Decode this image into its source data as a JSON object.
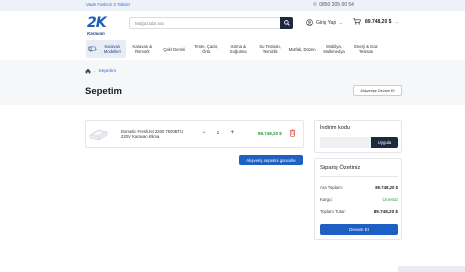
{
  "topbar": {
    "promo": "Vade Farksız 3 Taksit!",
    "phone": "0850 305 00 54"
  },
  "logo": {
    "mark": "2K",
    "sub": "Karavan"
  },
  "search": {
    "placeholder": "Mağazada ara"
  },
  "header": {
    "login_label": "Giriş Yap",
    "cart_amount": "89.748,20 $"
  },
  "nav": {
    "items": [
      {
        "label": "Karavan Modelleri"
      },
      {
        "label": "Karavan & Römork"
      },
      {
        "label": "Çekİ Demiri"
      },
      {
        "label": "Tente, Çadır, Örtü"
      },
      {
        "label": "Isıtma & Soğutma"
      },
      {
        "label": "Su Tesisatı, Temizlik"
      },
      {
        "label": "Mutfak, Düzen"
      },
      {
        "label": "Mobilya, Multimedya"
      },
      {
        "label": "Enerji & Gaz Tesisatı"
      }
    ]
  },
  "breadcrumb": {
    "current": "Sepetim"
  },
  "page": {
    "title": "Sepetim",
    "continue_label": "Alışverişe Devam Et"
  },
  "cart": {
    "items": [
      {
        "name": "Dometic FreshJet 2200 7500BTU 220V Karavan Klima",
        "quantity": "1",
        "price": "89.748,20 $"
      }
    ],
    "update_label": "Alışveriş sepetini güncelle"
  },
  "coupon": {
    "label": "İndirim kodu",
    "apply_label": "Uygula"
  },
  "summary": {
    "title": "Sipariş Özetiniz",
    "subtotal_label": "Ara Toplam:",
    "subtotal_value": "89.748,20 $",
    "shipping_label": "Kargo:",
    "shipping_value": "Ücretsiz",
    "total_label": "Toplam Tutar:",
    "total_value": "89.748,20 $",
    "cta_label": "Devam Et"
  },
  "colors": {
    "primary": "#1d5fc2",
    "dark": "#1b2a3e",
    "price_green": "#2a9a3c",
    "trash_red": "#e0413a"
  }
}
